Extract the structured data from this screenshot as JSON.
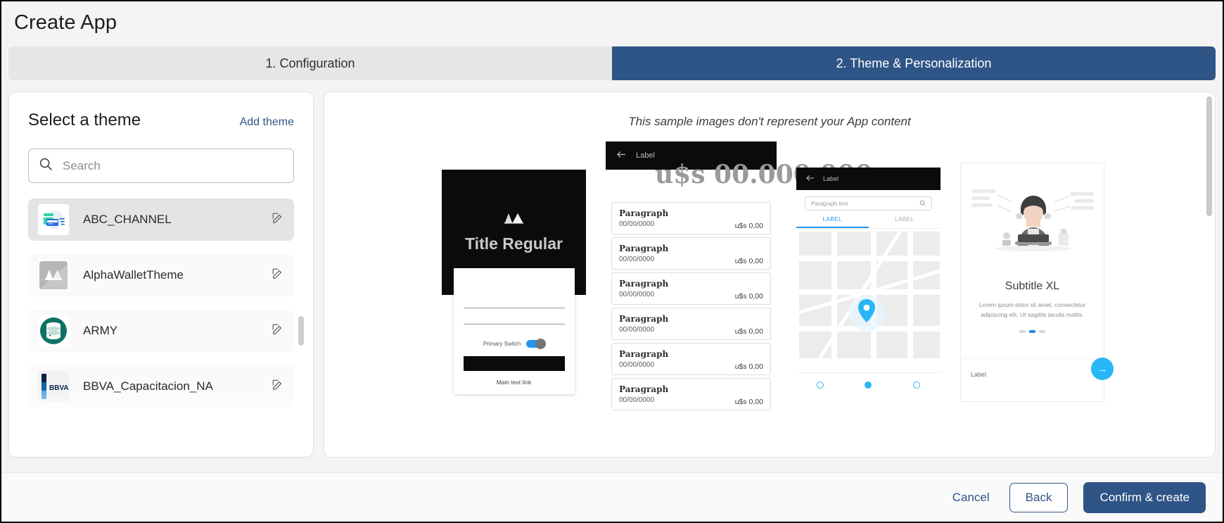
{
  "header": {
    "title": "Create App"
  },
  "steps": [
    {
      "label": "1. Configuration",
      "active": false
    },
    {
      "label": "2. Theme & Personalization",
      "active": true
    }
  ],
  "theme_panel": {
    "heading": "Select a theme",
    "add_theme_label": "Add theme",
    "search": {
      "placeholder": "Search",
      "value": ""
    },
    "items": [
      {
        "name": "ABC_CHANNEL",
        "selected": true,
        "icon": "abc-channel-logo"
      },
      {
        "name": "AlphaWalletTheme",
        "selected": false,
        "icon": "alphawallet-logo"
      },
      {
        "name": "ARMY",
        "selected": false,
        "icon": "army-database-logo"
      },
      {
        "name": "BBVA_Capacitacion_NA",
        "selected": false,
        "icon": "bbva-logo"
      }
    ]
  },
  "preview": {
    "note": "This sample images don't represent your App content",
    "mockup1": {
      "title": "Title Regular",
      "switch_label": "Primary Switch",
      "link_label": "Main text link"
    },
    "mockup2": {
      "bar_label": "Label",
      "amount": "u$s 00.000.000",
      "rows": [
        {
          "title": "Paragraph",
          "date": "00/00/0000",
          "amount": "u$s 0,00"
        },
        {
          "title": "Paragraph",
          "date": "00/00/0000",
          "amount": "u$s 0,00"
        },
        {
          "title": "Paragraph",
          "date": "00/00/0000",
          "amount": "u$s 0,00"
        },
        {
          "title": "Paragraph",
          "date": "00/00/0000",
          "amount": "u$s 0,00"
        },
        {
          "title": "Paragraph",
          "date": "00/00/0000",
          "amount": "u$s 0,00"
        },
        {
          "title": "Paragraph",
          "date": "00/00/0000",
          "amount": "u$s 0,00"
        }
      ]
    },
    "mockup3": {
      "bar_label": "Label",
      "search_placeholder": "Paragraph text",
      "tab_left": "LABEL",
      "tab_right": "LABEL"
    },
    "mockup4": {
      "subtitle": "Subtitle XL",
      "body": "Lorem ipsum dolor sit amet, consectetur adipiscing elit. Ut sagittis iaculis mattis.",
      "footer_label": "Label",
      "fab_icon": "arrow-right-icon"
    }
  },
  "footer": {
    "cancel": "Cancel",
    "back": "Back",
    "confirm": "Confirm & create"
  },
  "colors": {
    "accent": "#2f5486",
    "tab_inactive": "#e6e6e6",
    "link": "#2f5486"
  }
}
